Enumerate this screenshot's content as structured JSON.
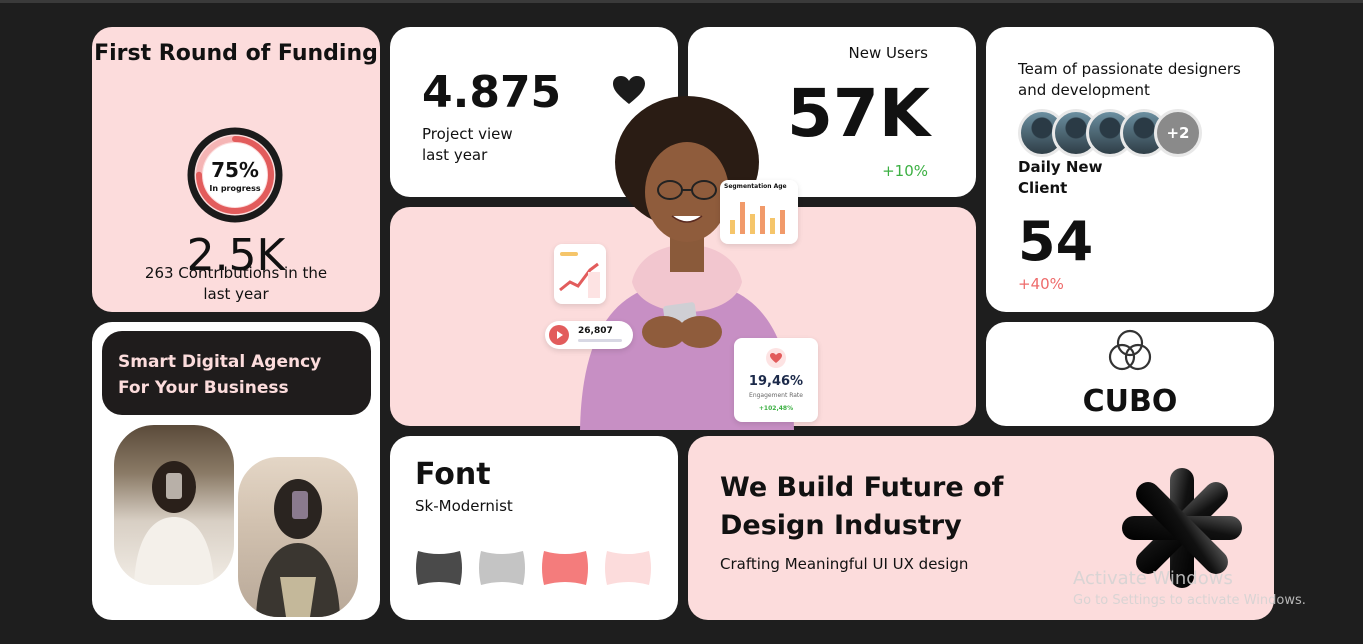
{
  "funding": {
    "title": "First Round of Funding",
    "progress_percent": "75%",
    "progress_value": 0.75,
    "progress_label": "In progress",
    "amount": "2.5K",
    "contributions": "263 Contributions in the last year"
  },
  "project": {
    "value": "4.875",
    "label": "Project view last year",
    "icon": "heart-icon"
  },
  "new_users": {
    "label": "New Users",
    "value": "57K",
    "delta": "+10%"
  },
  "team": {
    "label": "Team of passionate designers and development",
    "avatar_more": "+2",
    "daily_label": "Daily New Client",
    "daily_value": "54",
    "daily_delta": "+40%"
  },
  "hero": {
    "chart_title": "Segmentation Age",
    "views_count": "26,807",
    "engagement_value": "19,46%",
    "engagement_label": "Engagement Rate",
    "engagement_change": "+102,48%"
  },
  "agency": {
    "title": "Smart Digital Agency For Your Business"
  },
  "cubo": {
    "name": "CUBO"
  },
  "font_card": {
    "title": "Font",
    "font_name": "Sk-Modernist",
    "swatches": [
      "#4a4a4a",
      "#c4c4c4",
      "#f47c7c",
      "#fcdcdc"
    ]
  },
  "build": {
    "title": "We Build Future of Design Industry",
    "subtitle": "Crafting Meaningful UI UX design"
  },
  "activate": {
    "title": "Activate Windows",
    "subtitle": "Go to Settings to activate Windows."
  },
  "colors": {
    "background": "#1e1e1e",
    "pink": "#fcdcdc",
    "accent_red": "#e25c5c",
    "positive": "#3cb043",
    "negative": "#ee6b6b"
  }
}
